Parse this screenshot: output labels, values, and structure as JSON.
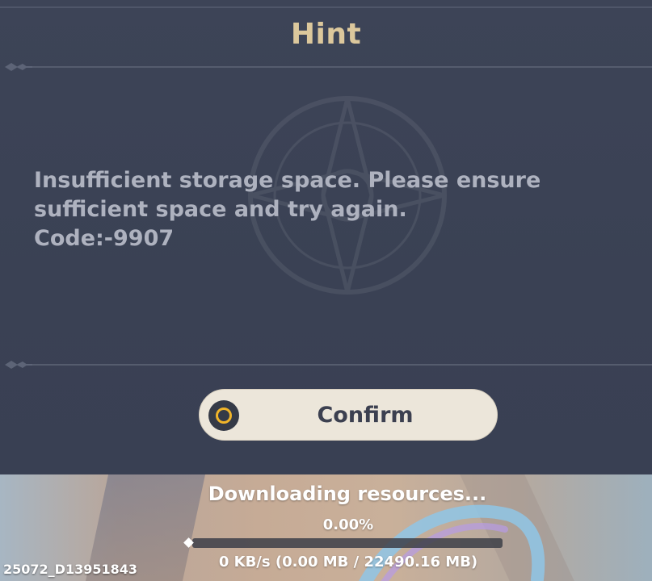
{
  "dialog": {
    "title": "Hint",
    "message_lines": [
      "Insufficient storage space. Please ensure",
      "sufficient space and try again.",
      "Code:-9907"
    ],
    "confirm_label": "Confirm",
    "confirm_icon": "circle-confirm-icon"
  },
  "download": {
    "status": "Downloading resources...",
    "percent_text": "0.00%",
    "progress": 0,
    "speed_text": "0 KB/s (0.00 MB / 22490.16 MB)"
  },
  "version": "25072_D13951843",
  "colors": {
    "dialog_bg": "#3a4154",
    "title": "#dcc89c",
    "message": "#aeb2bf",
    "button_bg": "#ece6da",
    "button_icon_ring": "#f0b429"
  }
}
